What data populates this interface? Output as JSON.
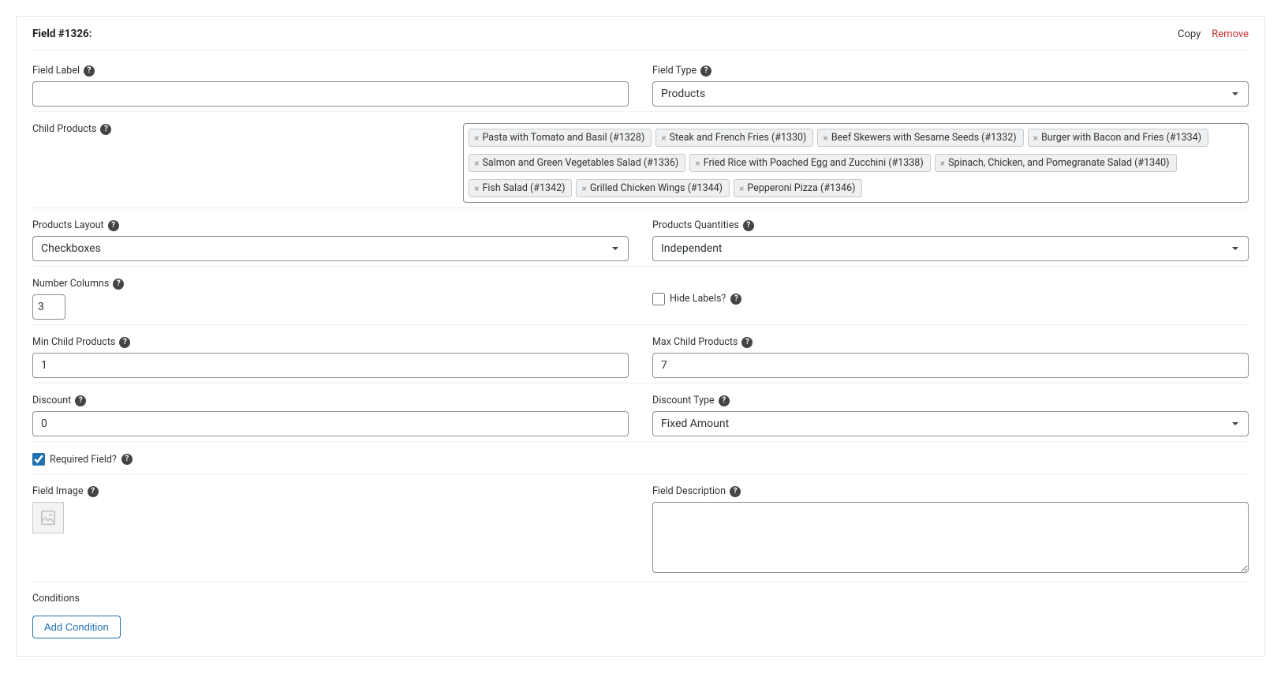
{
  "header": {
    "title": "Field #1326:",
    "copy_label": "Copy",
    "remove_label": "Remove"
  },
  "labels": {
    "field_label": "Field Label",
    "field_type": "Field Type",
    "child_products": "Child Products",
    "products_layout": "Products Layout",
    "products_quantities": "Products Quantities",
    "number_columns": "Number Columns",
    "hide_labels": "Hide Labels?",
    "min_child_products": "Min Child Products",
    "max_child_products": "Max Child Products",
    "discount": "Discount",
    "discount_type": "Discount Type",
    "required_field": "Required Field?",
    "field_image": "Field Image",
    "field_description": "Field Description",
    "conditions": "Conditions",
    "add_condition": "Add Condition"
  },
  "values": {
    "field_label": "",
    "field_type": "Products",
    "products_layout": "Checkboxes",
    "products_quantities": "Independent",
    "number_columns": "3",
    "hide_labels": false,
    "min_child_products": "1",
    "max_child_products": "7",
    "discount": "0",
    "discount_type": "Fixed Amount",
    "required_field": true,
    "field_description": ""
  },
  "child_products": [
    "Pasta with Tomato and Basil (#1328)",
    "Steak and French Fries (#1330)",
    "Beef Skewers with Sesame Seeds (#1332)",
    "Burger with Bacon and Fries (#1334)",
    "Salmon and Green Vegetables Salad (#1336)",
    "Fried Rice with Poached Egg and Zucchini (#1338)",
    "Spinach, Chicken, and Pomegranate Salad (#1340)",
    "Fish Salad (#1342)",
    "Grilled Chicken Wings (#1344)",
    "Pepperoni Pizza (#1346)"
  ]
}
